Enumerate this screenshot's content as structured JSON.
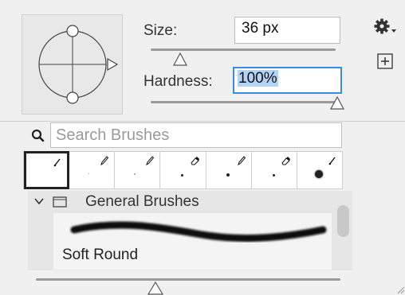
{
  "brush_settings": {
    "size_label": "Size:",
    "size_value": "36 px",
    "size_slider_fraction": 0.17,
    "hardness_label": "Hardness:",
    "hardness_value": "100%",
    "hardness_slider_fraction": 1.0
  },
  "toolbar": {
    "settings_icon": "gear-icon",
    "new_preset_icon": "plus-square-icon"
  },
  "search": {
    "placeholder": "Search Brushes"
  },
  "recent_brushes": [
    {
      "icon": "brush-icon",
      "selected": true
    },
    {
      "icon": "pencil-icon"
    },
    {
      "icon": "pencil-icon"
    },
    {
      "icon": "eraser-icon"
    },
    {
      "icon": "pencil-icon"
    },
    {
      "icon": "eraser-icon"
    },
    {
      "icon": "brush-icon"
    }
  ],
  "brush_list": {
    "group_label": "General Brushes",
    "items": [
      {
        "label": "Soft Round"
      }
    ]
  },
  "preview_size_fraction": 0.4,
  "colors": {
    "accent": "#3a8ce0",
    "selection": "#b3d3f7",
    "panel_bg": "#f0f0f0"
  }
}
